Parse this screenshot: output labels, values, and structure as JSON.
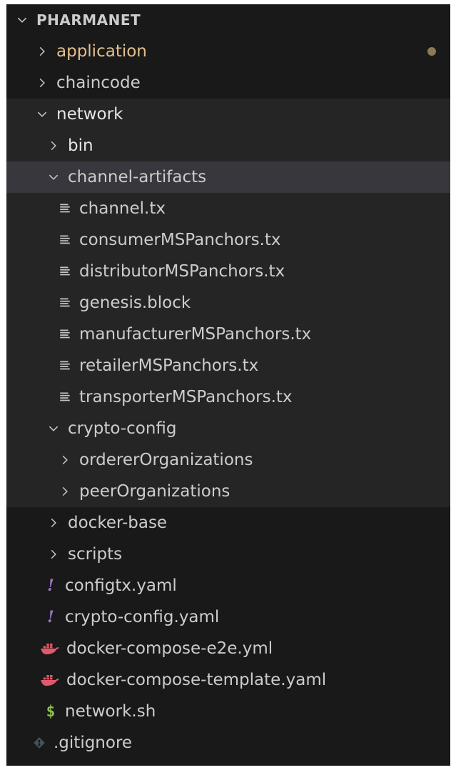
{
  "explorer": {
    "title": "PHARMANET",
    "colors": {
      "background": "#191919",
      "tree_background": "#252526",
      "selected_background": "#37373d",
      "text": "#cccccc",
      "modified_text": "#e2c08d",
      "yaml_icon": "#a074c4",
      "docker_icon": "#e05a6a",
      "shell_icon": "#8dc149",
      "git_icon": "#41535b"
    },
    "items": [
      {
        "label": "application",
        "icon": "chevron-right-icon",
        "modified": true
      },
      {
        "label": "chaincode",
        "icon": "chevron-right-icon"
      },
      {
        "label": "network",
        "icon": "chevron-down-icon"
      },
      {
        "label": "bin",
        "icon": "chevron-right-icon"
      },
      {
        "label": "channel-artifacts",
        "icon": "chevron-down-icon"
      },
      {
        "label": "channel.tx",
        "icon": "text-file-icon"
      },
      {
        "label": "consumerMSPanchors.tx",
        "icon": "text-file-icon"
      },
      {
        "label": "distributorMSPanchors.tx",
        "icon": "text-file-icon"
      },
      {
        "label": "genesis.block",
        "icon": "text-file-icon"
      },
      {
        "label": "manufacturerMSPanchors.tx",
        "icon": "text-file-icon"
      },
      {
        "label": "retailerMSPanchors.tx",
        "icon": "text-file-icon"
      },
      {
        "label": "transporterMSPanchors.tx",
        "icon": "text-file-icon"
      },
      {
        "label": "crypto-config",
        "icon": "chevron-down-icon"
      },
      {
        "label": "ordererOrganizations",
        "icon": "chevron-right-icon"
      },
      {
        "label": "peerOrganizations",
        "icon": "chevron-right-icon"
      },
      {
        "label": "docker-base",
        "icon": "chevron-right-icon"
      },
      {
        "label": "scripts",
        "icon": "chevron-right-icon"
      },
      {
        "label": "configtx.yaml",
        "icon": "yaml-icon",
        "glyph": "!"
      },
      {
        "label": "crypto-config.yaml",
        "icon": "yaml-icon",
        "glyph": "!"
      },
      {
        "label": "docker-compose-e2e.yml",
        "icon": "docker-icon"
      },
      {
        "label": "docker-compose-template.yaml",
        "icon": "docker-icon"
      },
      {
        "label": "network.sh",
        "icon": "shell-icon",
        "glyph": "$"
      },
      {
        "label": ".gitignore",
        "icon": "git-icon"
      }
    ]
  }
}
